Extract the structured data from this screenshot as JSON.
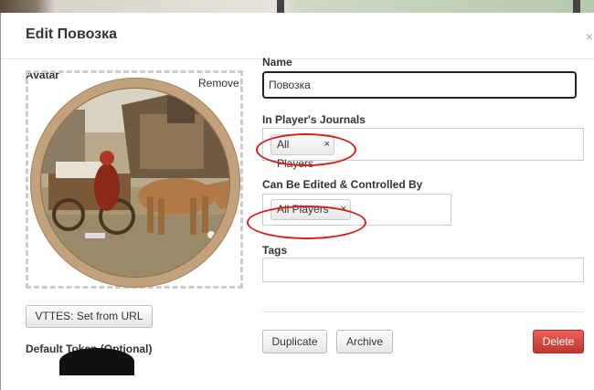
{
  "dialog": {
    "title": "Edit Повозка",
    "close_glyph": "×"
  },
  "avatar": {
    "label": "Avatar",
    "remove_label": "Remove",
    "image_icon": "portrait-image"
  },
  "set_from_url_label": "VTTES: Set from URL",
  "default_token_label": "Default Token (Optional)",
  "name": {
    "label": "Name",
    "value": "Повозка"
  },
  "journals": {
    "label": "In Player's Journals",
    "chips": [
      {
        "label": "All Players",
        "remove_glyph": "×"
      }
    ]
  },
  "controlled_by": {
    "label": "Can Be Edited & Controlled By",
    "chips": [
      {
        "label": "All Players",
        "remove_glyph": "×"
      }
    ]
  },
  "tags": {
    "label": "Tags",
    "value": ""
  },
  "actions": {
    "duplicate_label": "Duplicate",
    "archive_label": "Archive",
    "delete_label": "Delete"
  },
  "colors": {
    "annotation_oval": "#d42020",
    "delete_button": "#d9534f",
    "avatar_frame": "#c2a27c"
  }
}
